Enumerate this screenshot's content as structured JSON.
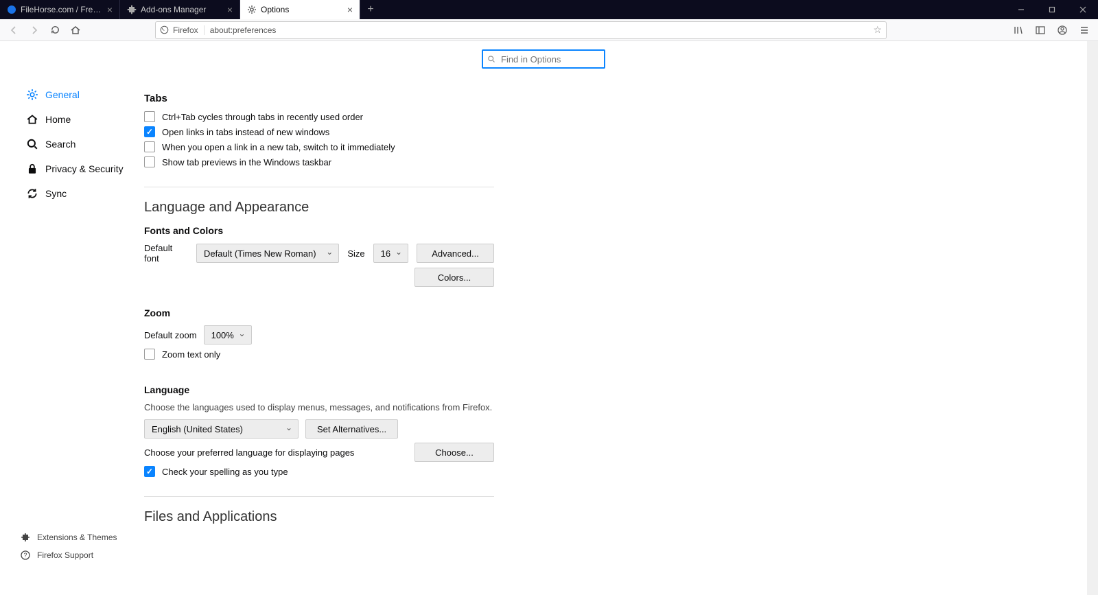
{
  "tabs": [
    {
      "label": "FileHorse.com / Free Software",
      "active": false
    },
    {
      "label": "Add-ons Manager",
      "active": false
    },
    {
      "label": "Options",
      "active": true
    }
  ],
  "url": {
    "identity": "Firefox",
    "value": "about:preferences"
  },
  "search": {
    "placeholder": "Find in Options"
  },
  "sidebar": {
    "items": [
      {
        "label": "General",
        "active": true
      },
      {
        "label": "Home"
      },
      {
        "label": "Search"
      },
      {
        "label": "Privacy & Security"
      },
      {
        "label": "Sync"
      }
    ],
    "bottom": [
      {
        "label": "Extensions & Themes"
      },
      {
        "label": "Firefox Support"
      }
    ]
  },
  "tabs_section": {
    "title": "Tabs",
    "opts": [
      {
        "label": "Ctrl+Tab cycles through tabs in recently used order",
        "checked": false
      },
      {
        "label": "Open links in tabs instead of new windows",
        "checked": true
      },
      {
        "label": "When you open a link in a new tab, switch to it immediately",
        "checked": false
      },
      {
        "label": "Show tab previews in the Windows taskbar",
        "checked": false
      }
    ]
  },
  "lang_appear": {
    "title": "Language and Appearance"
  },
  "fonts": {
    "title": "Fonts and Colors",
    "default_font_label": "Default font",
    "default_font_value": "Default (Times New Roman)",
    "size_label": "Size",
    "size_value": "16",
    "advanced": "Advanced...",
    "colors": "Colors..."
  },
  "zoom": {
    "title": "Zoom",
    "default_label": "Default zoom",
    "default_value": "100%",
    "text_only": {
      "label": "Zoom text only",
      "checked": false
    }
  },
  "language": {
    "title": "Language",
    "desc": "Choose the languages used to display menus, messages, and notifications from Firefox.",
    "locale": "English (United States)",
    "alternatives": "Set Alternatives...",
    "pages_desc": "Choose your preferred language for displaying pages",
    "choose": "Choose...",
    "spell": {
      "label": "Check your spelling as you type",
      "checked": true
    }
  },
  "files_apps": {
    "title": "Files and Applications"
  }
}
